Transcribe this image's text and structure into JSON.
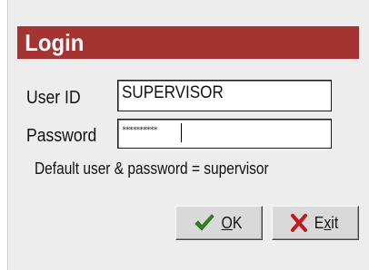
{
  "dialog": {
    "title": "Login"
  },
  "fields": {
    "user_id_label": "User ID",
    "user_id_value": "SUPERVISOR",
    "password_label": "Password",
    "password_mask": "**********"
  },
  "hint": "Default user & password = supervisor",
  "buttons": {
    "ok": {
      "pre": "",
      "mnemonic": "O",
      "post": "K",
      "icon": "checkmark-icon",
      "icon_color": "#2f8a1e"
    },
    "exit": {
      "pre": "E",
      "mnemonic": "x",
      "post": "it",
      "icon": "x-icon",
      "icon_color": "#c0191b"
    }
  },
  "colors": {
    "title_bar": "#a43331",
    "dialog_bg": "#ededed"
  }
}
